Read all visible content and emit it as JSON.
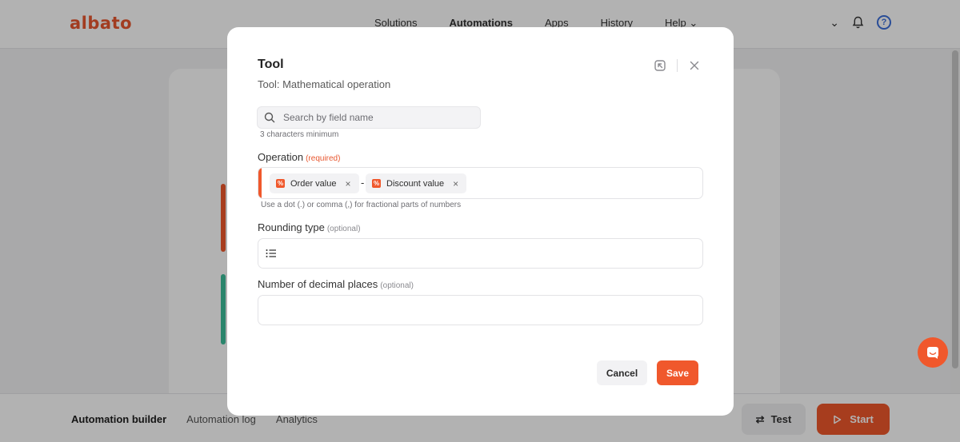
{
  "app": {
    "logo": "albato",
    "nav": [
      "Solutions",
      "Automations",
      "Apps",
      "History",
      "Help"
    ],
    "nav_active": "Automations",
    "help_badge": "?"
  },
  "bottom": {
    "tabs": [
      "Automation builder",
      "Automation log",
      "Analytics"
    ],
    "test_label": "Test",
    "start_label": "Start"
  },
  "modal": {
    "title": "Tool",
    "subtitle": "Tool: Mathematical operation",
    "search": {
      "placeholder": "Search by field name",
      "value": "",
      "hint": "3 characters minimum"
    },
    "operation": {
      "label": "Operation",
      "required_text": "(required)",
      "chips": [
        "Order value",
        "Discount value"
      ],
      "operator": "-",
      "hint": "Use a dot (.) or comma (,) for fractional parts of numbers"
    },
    "rounding": {
      "label": "Rounding type",
      "optional_text": "(optional)",
      "value": ""
    },
    "decimals": {
      "label": "Number of decimal places",
      "optional_text": "(optional)",
      "value": ""
    },
    "cancel_label": "Cancel",
    "save_label": "Save"
  },
  "colors": {
    "accent": "#f0582c",
    "brand": "#e8572f",
    "help": "#3b6fd9"
  },
  "icons": [
    "search-icon",
    "collapse-icon",
    "close-icon",
    "list-icon",
    "bell-icon",
    "chevron-down-icon",
    "swap-icon",
    "play-icon",
    "chat-icon",
    "field-tag-icon"
  ]
}
